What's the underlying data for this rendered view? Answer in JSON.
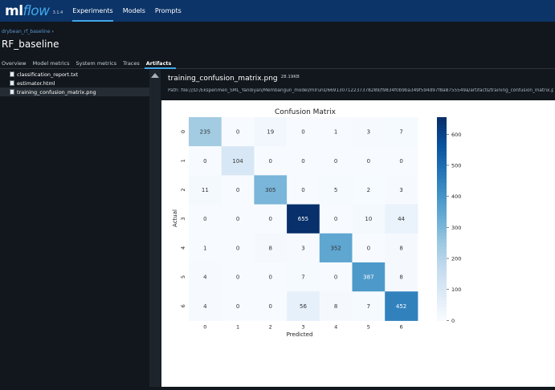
{
  "topbar": {
    "logo_a": "ml",
    "logo_b": "flow",
    "version": "3.1.4",
    "nav": [
      "Experiments",
      "Models",
      "Prompts"
    ],
    "active": "Experiments"
  },
  "breadcrumb": "drybean_rf_baseline",
  "breadcrumb_sep": "›",
  "title": "RF_baseline",
  "tabs": [
    "Overview",
    "Model metrics",
    "System metrics",
    "Traces",
    "Artifacts"
  ],
  "active_tab": "Artifacts",
  "files": [
    "classification_report.txt",
    "estimator.html",
    "training_confusion_matrix.png"
  ],
  "selected_file": "training_confusion_matrix.png",
  "preview": {
    "name": "training_confusion_matrix.png",
    "size": "28.19KB",
    "path": "Path: file:///D:/Eksperimen_SML_Yandiyan/Membangun_model/mlruns/669130712237378289/f9834f0b9ba349f594d97f8a8755549a/artifacts/training_confusion_matrix.png"
  },
  "chart_data": {
    "type": "heatmap",
    "title": "Confusion Matrix",
    "xlabel": "Predicted",
    "ylabel": "Actual",
    "x_ticks": [
      "0",
      "1",
      "2",
      "3",
      "4",
      "5",
      "6"
    ],
    "y_ticks": [
      "0",
      "1",
      "2",
      "3",
      "4",
      "5",
      "6"
    ],
    "values": [
      [
        235,
        0,
        19,
        0,
        1,
        3,
        7
      ],
      [
        0,
        104,
        0,
        0,
        0,
        0,
        0
      ],
      [
        11,
        0,
        305,
        0,
        5,
        2,
        3
      ],
      [
        0,
        0,
        0,
        655,
        0,
        10,
        44
      ],
      [
        1,
        0,
        8,
        3,
        352,
        0,
        8
      ],
      [
        4,
        0,
        0,
        7,
        0,
        387,
        8
      ],
      [
        4,
        0,
        0,
        56,
        8,
        7,
        452
      ]
    ],
    "colormap": "Blues",
    "colorbar": {
      "range": [
        0,
        655
      ],
      "ticks": [
        0,
        100,
        200,
        300,
        400,
        500,
        600
      ]
    }
  }
}
